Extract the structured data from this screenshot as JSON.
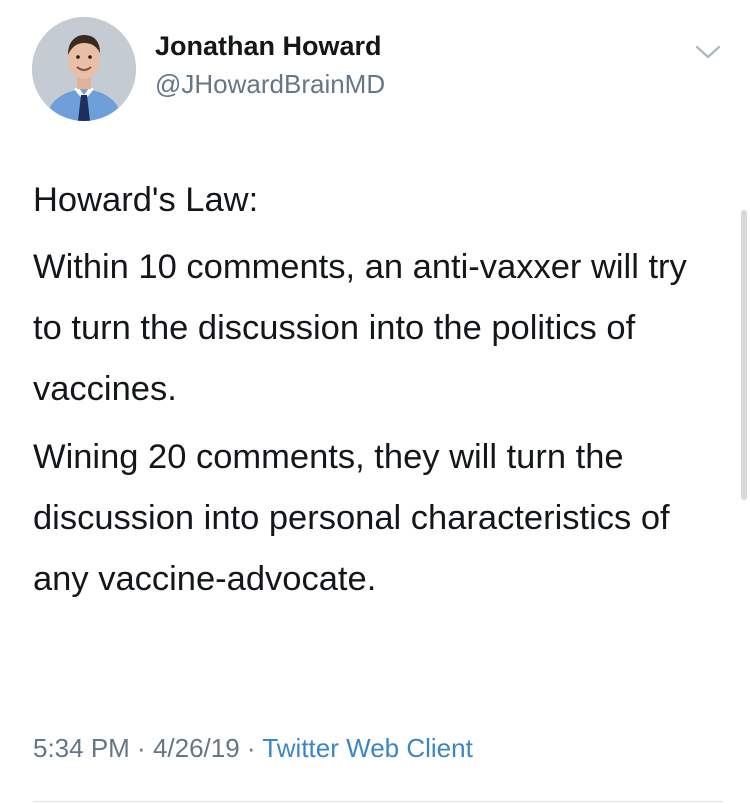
{
  "author": {
    "display_name": "Jonathan Howard",
    "handle": "@JHowardBrainMD"
  },
  "tweet": {
    "paragraphs": [
      "Howard's Law:",
      "Within 10 comments, an anti-vaxxer will try to turn the discussion into the politics of vaccines.",
      "Wining 20 comments, they will turn the discussion into personal characteristics of any vaccine-advocate."
    ]
  },
  "meta": {
    "time": "5:34 PM",
    "separator": " · ",
    "date": "4/26/19",
    "source": "Twitter Web Client"
  },
  "icons": {
    "menu": "chevron-down-icon"
  },
  "colors": {
    "text": "#14171a",
    "secondary": "#657786",
    "link": "#3d86c6"
  }
}
